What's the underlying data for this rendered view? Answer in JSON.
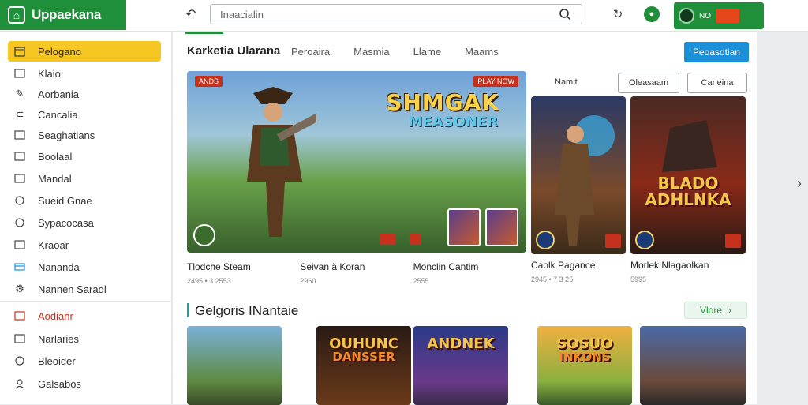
{
  "brand": {
    "mark": "⌂",
    "name": "Uppaekana"
  },
  "search": {
    "placeholder": "Inaacialin"
  },
  "account": {
    "badge": "NO"
  },
  "sidebar": {
    "items": [
      {
        "label": "Pelogano",
        "icon": "calendar-icon"
      },
      {
        "label": "Klaio",
        "icon": "square-icon"
      },
      {
        "label": "Aorbania",
        "icon": "pen-icon"
      },
      {
        "label": "Cancalia",
        "icon": "link-icon"
      },
      {
        "label": "Seaghatians",
        "icon": "square-icon"
      },
      {
        "label": "Boolaal",
        "icon": "square-icon"
      },
      {
        "label": "Mandal",
        "icon": "square-icon"
      },
      {
        "label": "Sueid Gnae",
        "icon": "circle-icon"
      },
      {
        "label": "Sypacocasa",
        "icon": "circle-icon"
      },
      {
        "label": "Kraoar",
        "icon": "square-icon"
      },
      {
        "label": "Nananda",
        "icon": "card-icon"
      },
      {
        "label": "Nannen Saradl",
        "icon": "gear-icon"
      },
      {
        "label": "Aodianr",
        "icon": "square-icon"
      },
      {
        "label": "Narlaries",
        "icon": "square-icon"
      },
      {
        "label": "Bleoider",
        "icon": "circle-icon"
      },
      {
        "label": "Galsabos",
        "icon": "person-icon"
      }
    ]
  },
  "main": {
    "title": "Karketia Ularana",
    "tabs": [
      "Peroaira",
      "Masmia",
      "Llame",
      "Maams"
    ],
    "primary_button": "Peoasdtian",
    "filter": {
      "label": "Namit",
      "button1": "Oleasaam",
      "button2": "Carleina"
    },
    "hero": {
      "tag1": "ANDS",
      "tag2": "PLAY NOW",
      "title": "SHMGAK",
      "subtitle": "MEASONER",
      "infos": [
        {
          "title": "Tlodche Steam",
          "meta": "2495 • 3 2553"
        },
        {
          "title": "Seivan ä Koran",
          "meta": "2960"
        },
        {
          "title": "Monclin Cantim",
          "meta": "2555"
        }
      ]
    },
    "cards": [
      {
        "title": "Caolk Pagance",
        "meta": "2945 • 7 3 25",
        "art": ""
      },
      {
        "title": "Morlek Nlagaolkan",
        "meta": "5995",
        "art": "BLADO ADHLNKA"
      }
    ],
    "section": {
      "title": "Gelgoris INantaie",
      "more": "Vlore"
    },
    "grid": [
      {
        "title": "",
        "sub": ""
      },
      {
        "title": "OUHUNC",
        "sub": "DANSSER"
      },
      {
        "title": "ANDNEK",
        "sub": ""
      },
      {
        "title": "SOSUO",
        "sub": "INKONS"
      },
      {
        "title": "",
        "sub": ""
      }
    ]
  },
  "colors": {
    "brand_green": "#1f8f3a",
    "accent_yellow": "#f6c623",
    "primary_blue": "#1b8fd8",
    "danger_red": "#c4321e"
  }
}
